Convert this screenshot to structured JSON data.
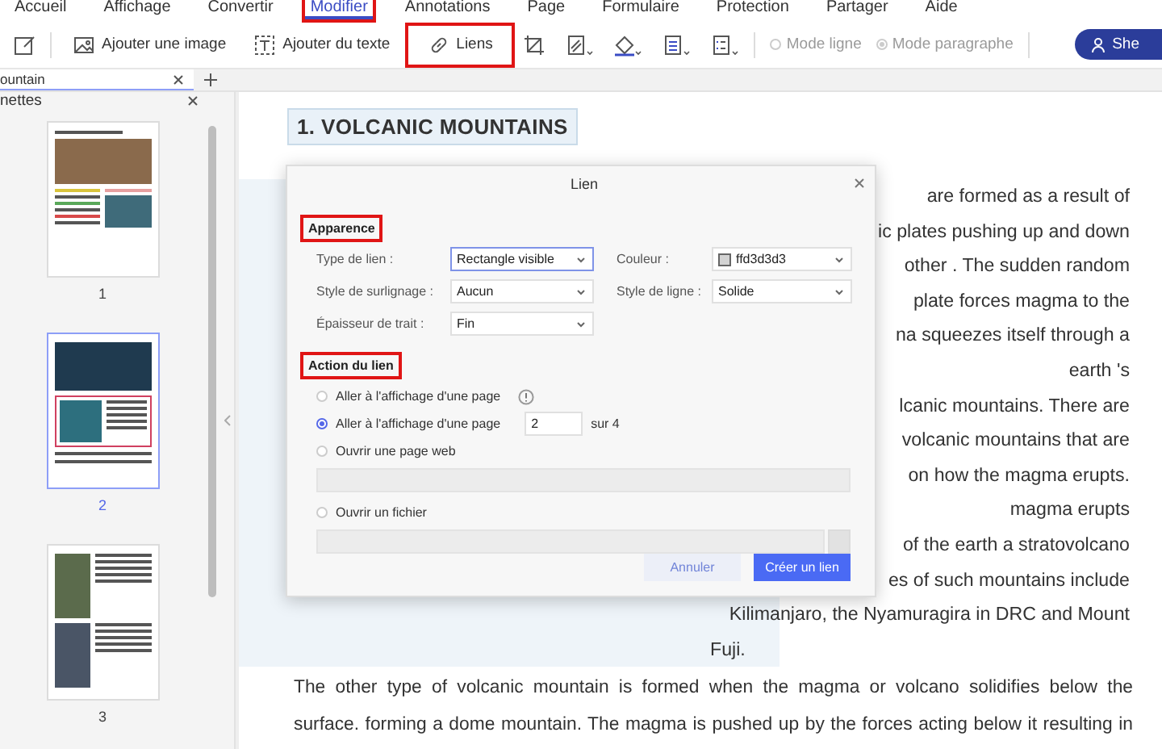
{
  "menu": [
    {
      "label": "Accueil",
      "selected": false,
      "outlined": false
    },
    {
      "label": "Affichage",
      "selected": false,
      "outlined": false
    },
    {
      "label": "Convertir",
      "selected": false,
      "outlined": false
    },
    {
      "label": "Modifier",
      "selected": true,
      "outlined": true
    },
    {
      "label": "Annotations",
      "selected": false,
      "outlined": false
    },
    {
      "label": "Page",
      "selected": false,
      "outlined": false
    },
    {
      "label": "Formulaire",
      "selected": false,
      "outlined": false
    },
    {
      "label": "Protection",
      "selected": false,
      "outlined": false
    },
    {
      "label": "Partager",
      "selected": false,
      "outlined": false
    },
    {
      "label": "Aide",
      "selected": false,
      "outlined": false
    }
  ],
  "toolbar": {
    "tools": [
      {
        "kind": "image",
        "label": "Ajouter une image",
        "outlined": false
      },
      {
        "kind": "text",
        "label": "Ajouter du texte",
        "outlined": false
      },
      {
        "kind": "link",
        "label": "Liens",
        "outlined": true
      }
    ],
    "modes": [
      {
        "label": "Mode ligne",
        "selected": false,
        "disabled": true
      },
      {
        "label": "Mode paragraphe",
        "selected": true,
        "disabled": true
      }
    ],
    "share_button": "She"
  },
  "tabs": [
    {
      "label": "ountain",
      "selected": true
    }
  ],
  "thumbnails": {
    "title": "nettes",
    "pages": [
      {
        "label": "1",
        "selected": false
      },
      {
        "label": "2",
        "selected": true
      },
      {
        "label": "3",
        "selected": false
      }
    ]
  },
  "document": {
    "heading": "1. VOLCANIC MOUNTAINS",
    "column_lines": [
      "are formed as a result of",
      "ic plates pushing up and down",
      "other . The sudden random",
      "plate forces magma to the",
      "na squeezes itself through a",
      "earth 's",
      "lcanic mountains. There are",
      "volcanic mountains that are",
      "on how the magma erupts.",
      "magma erupts",
      "of the earth a stratovolcano",
      "es of such mountains include",
      "Kilimanjaro, the Nyamuragira in DRC and Mount",
      "Fuji."
    ],
    "paragraph_lines": [
      "The other type of volcanic mountain is formed when the magma or volcano solidifies below the",
      "surface. forming a dome mountain. The magma is pushed up by the forces acting below it resulting in"
    ]
  },
  "dialog": {
    "title": "Lien",
    "appearance": {
      "heading": "Apparence",
      "outlined": true,
      "fields": [
        {
          "kind": "select",
          "label": "Type de lien :",
          "value": "Rectangle visible",
          "focused": true
        },
        {
          "kind": "color",
          "label": "Couleur :",
          "value": "ffd3d3d3",
          "focused": false
        },
        {
          "kind": "select",
          "label": "Style de surlignage :",
          "value": "Aucun",
          "focused": false
        },
        {
          "kind": "select",
          "label": "Style de ligne :",
          "value": "Solide",
          "focused": false
        },
        {
          "kind": "select",
          "label": "Épaisseur de trait :",
          "value": "Fin",
          "focused": false
        }
      ]
    },
    "action": {
      "heading": "Action du lien",
      "outlined": true,
      "options": [
        {
          "kind": "info",
          "label": "Aller à l'affichage d'une page",
          "selected": false
        },
        {
          "kind": "page",
          "label": "Aller à l'affichage d'une page",
          "selected": true,
          "page_value": "2",
          "page_total": "sur 4"
        },
        {
          "kind": "url",
          "label": "Ouvrir une page web",
          "selected": false
        },
        {
          "kind": "file",
          "label": "Ouvrir un fichier",
          "selected": false
        }
      ]
    },
    "cancel_button": "Annuler",
    "confirm_button": "Créer un lien"
  }
}
